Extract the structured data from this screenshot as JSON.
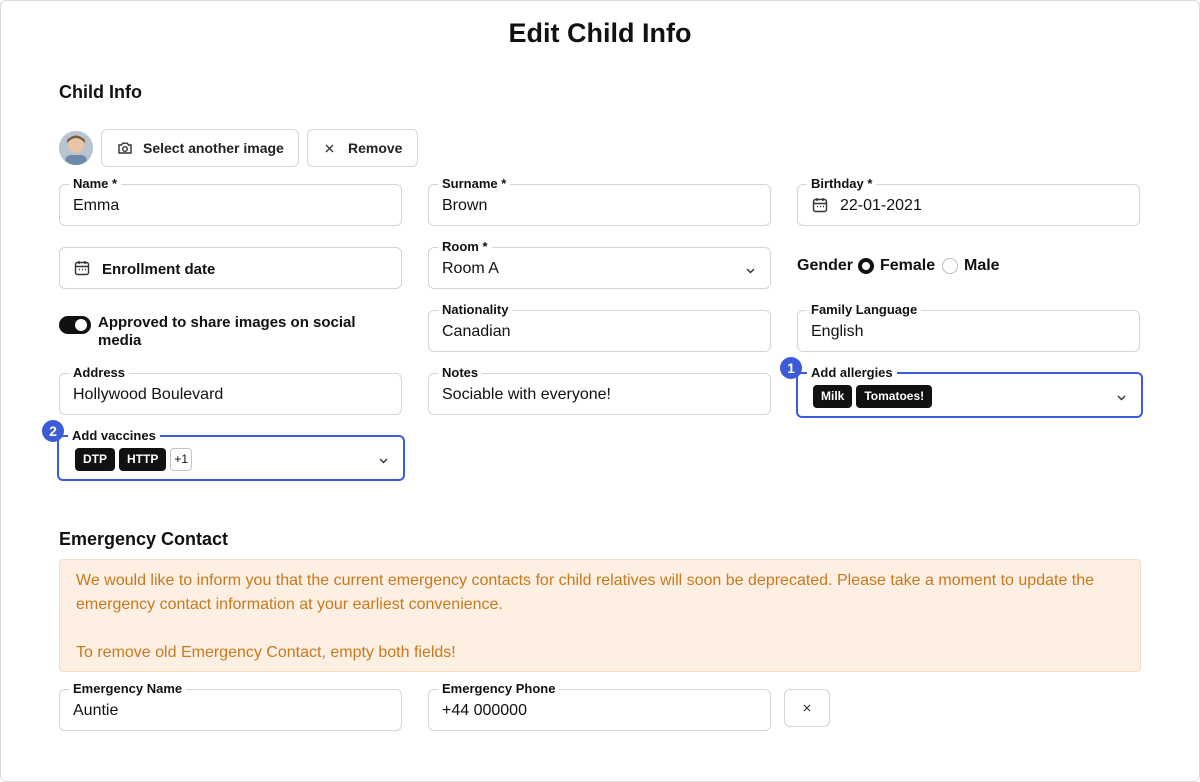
{
  "title": "Edit Child Info",
  "child_info": {
    "heading": "Child Info",
    "select_image_label": "Select another image",
    "remove_label": "Remove",
    "name": {
      "label": "Name *",
      "value": "Emma"
    },
    "surname": {
      "label": "Surname *",
      "value": "Brown"
    },
    "birthday": {
      "label": "Birthday *",
      "value": "22-01-2021"
    },
    "enrollment": {
      "label": "Enrollment date"
    },
    "room": {
      "label": "Room *",
      "value": "Room A"
    },
    "gender": {
      "label": "Gender",
      "options": [
        "Female",
        "Male"
      ],
      "selected": "Female"
    },
    "social": {
      "label": "Approved to share images on social media",
      "enabled": true
    },
    "nationality": {
      "label": "Nationality",
      "value": "Canadian"
    },
    "family_language": {
      "label": "Family Language",
      "value": "English"
    },
    "address": {
      "label": "Address",
      "value": "Hollywood Boulevard"
    },
    "notes": {
      "label": "Notes",
      "value": "Sociable with everyone!"
    },
    "allergies": {
      "label": "Add allergies",
      "tags": [
        "Milk",
        "Tomatoes!"
      ],
      "marker": "1"
    },
    "vaccines": {
      "label": "Add vaccines",
      "tags": [
        "DTP",
        "HTTP"
      ],
      "more": "+1",
      "marker": "2"
    }
  },
  "emergency": {
    "heading": "Emergency Contact",
    "notice_line1": "We would like to inform you that the current emergency contacts for child relatives will soon be deprecated. Please take a moment to update the emergency contact information at your earliest convenience.",
    "notice_line2": "To remove old Emergency Contact, empty both fields!",
    "name": {
      "label": "Emergency Name",
      "value": "Auntie"
    },
    "phone": {
      "label": "Emergency Phone",
      "value": "+44 000000"
    }
  },
  "colors": {
    "accent": "#3b5bdb",
    "notice_bg": "#fdf0e3",
    "notice_text": "#c8781e"
  }
}
